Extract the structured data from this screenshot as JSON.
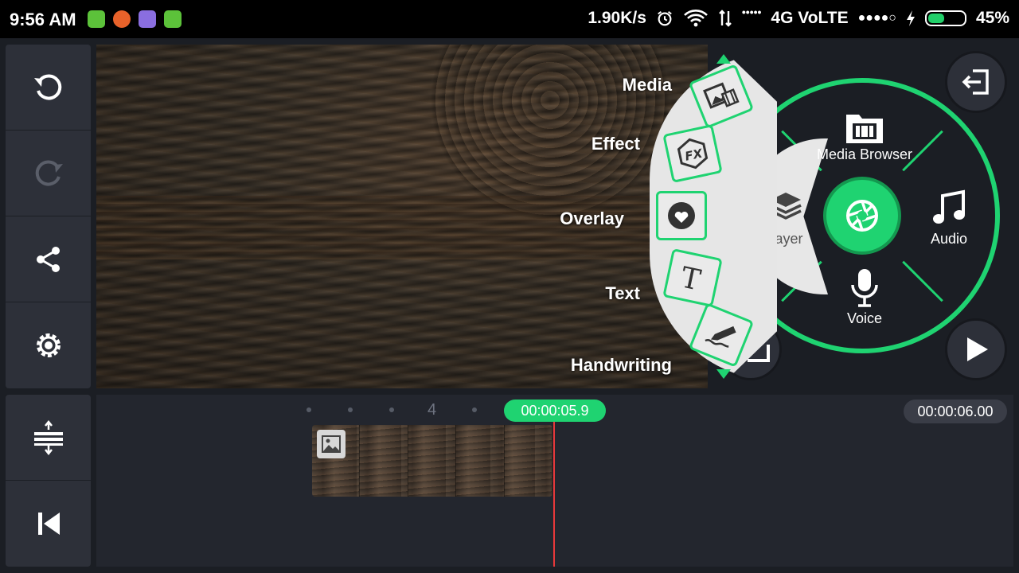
{
  "status_bar": {
    "time": "9:56 AM",
    "speed": "1.90K/s",
    "signal_dots": "•••••",
    "network": "4G VoLTE",
    "carrier_dots": "●●●●○",
    "battery_percent": "45%",
    "battery_level": 0.45,
    "app_icons": [
      {
        "name": "green-app-icon",
        "color": "#5cc23a"
      },
      {
        "name": "firefox-icon",
        "color": "#e8622a"
      },
      {
        "name": "purple-app-icon",
        "color": "#8a6ee0"
      },
      {
        "name": "android-app-icon",
        "color": "#5cc23a"
      }
    ]
  },
  "toolbar": {
    "top": [
      {
        "name": "undo-button",
        "icon": "undo-icon"
      },
      {
        "name": "redo-button",
        "icon": "redo-icon"
      },
      {
        "name": "share-button",
        "icon": "share-icon"
      },
      {
        "name": "settings-button",
        "icon": "gear-icon"
      }
    ],
    "bottom": [
      {
        "name": "timeline-expand-button",
        "icon": "expand-vertical-icon"
      },
      {
        "name": "skip-to-start-button",
        "icon": "skip-start-icon"
      }
    ]
  },
  "arc_menu": {
    "items": [
      {
        "label": "Media",
        "icon": "media-icon"
      },
      {
        "label": "Effect",
        "icon": "fx-icon"
      },
      {
        "label": "Overlay",
        "icon": "sticker-icon"
      },
      {
        "label": "Text",
        "icon": "text-icon"
      },
      {
        "label": "Handwriting",
        "icon": "pen-icon"
      }
    ]
  },
  "wheel": {
    "top_label": "Media Browser",
    "left_label": "Layer",
    "right_label": "Audio",
    "bottom_label": "Voice",
    "center_icon": "camera-shutter-icon"
  },
  "timeline": {
    "tick_label": "4",
    "current_time": "00:00:05.9",
    "total_time": "00:00:06.00"
  },
  "colors": {
    "accent": "#1fd371",
    "panel": "#2d3039",
    "background": "#1b1e24",
    "playhead": "#e8383a"
  }
}
